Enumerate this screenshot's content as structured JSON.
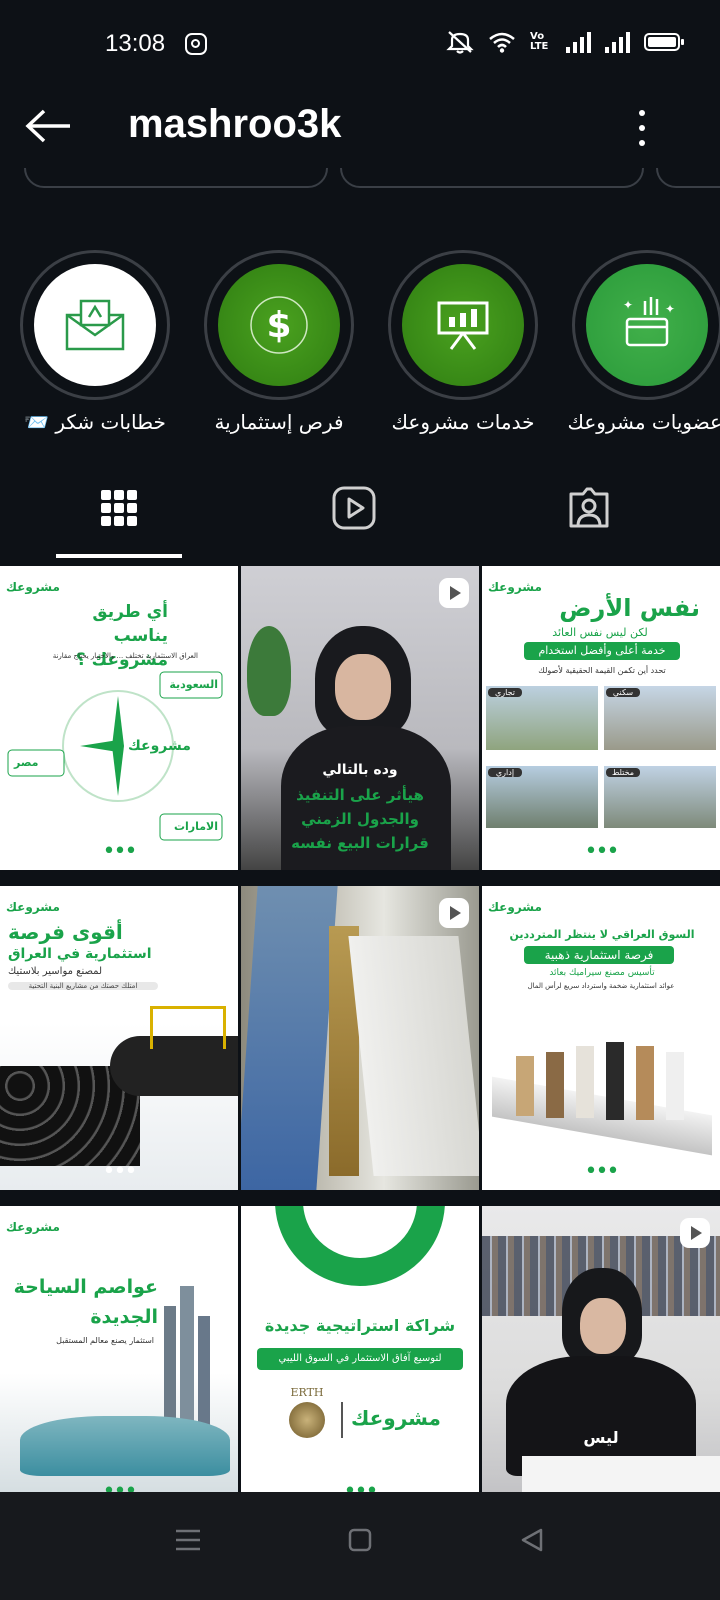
{
  "status_bar": {
    "time": "13:08",
    "network_label": "Vo LTE"
  },
  "header": {
    "username": "mashroo3k"
  },
  "highlights": [
    {
      "label": "خطابات شكر 📨",
      "icon": "envelope-icon",
      "style": "white"
    },
    {
      "label": "فرص إستثمارية",
      "icon": "dollar-icon",
      "style": "green"
    },
    {
      "label": "خدمات مشروعك",
      "icon": "presentation-chart-icon",
      "style": "green"
    },
    {
      "label": "عضويات مشروعك",
      "icon": "membership-card-icon",
      "style": "green"
    }
  ],
  "tabs": [
    {
      "name": "grid",
      "icon": "grid-icon",
      "active": true
    },
    {
      "name": "reels",
      "icon": "reels-icon",
      "active": false
    },
    {
      "name": "tagged",
      "icon": "tagged-person-icon",
      "active": false
    }
  ],
  "posts": [
    {
      "logo": "مشروعك",
      "title": "أي طريق يناسب مشروعك ؟",
      "subtitle": "العراق الاستثمارية تختلف ... والاختيار يحتاج مقارنة",
      "labels": [
        "السعودية",
        "مصر",
        "الامارات"
      ],
      "center": "مشروعك"
    },
    {
      "caption_lines": [
        "وده بالتالي",
        "هيأثر على التنفيذ",
        "والجدول الزمني",
        "قرارات البيع نفسه"
      ],
      "is_reel": true
    },
    {
      "logo": "مشروعك",
      "title": "نفس الأرض",
      "subtitle": "لكن ليس نفس العائد",
      "pill": "خدمة أعلى وأفضل استخدام",
      "note": "تحدد أين تكمن القيمة الحقيقية لأصولك",
      "tags": [
        "تجاري",
        "سكني",
        "إداري",
        "مختلط"
      ]
    },
    {
      "logo": "مشروعك",
      "title": "أقوى فرصة",
      "subtitle": "استثمارية في العراق",
      "note": "لمصنع مواسير بلاستيك",
      "pill": "امتلك حصتك من مشاريع البنية التحتية"
    },
    {
      "is_reel": true
    },
    {
      "logo": "مشروعك",
      "title": "السوق العراقي لا ينتظر المترددين",
      "pill": "فرصة استثمارية ذهبية",
      "subtitle": "تأسيس مصنع سيراميك بعائد",
      "note": "عوائد استثمارية ضخمة واسترداد سريع لرأس المال"
    },
    {
      "logo": "مشروعك",
      "title": "عواصم السياحة الجديدة",
      "note": "استثمار يصنع معالم المستقبل"
    },
    {
      "title": "شراكة استراتيجية جديدة",
      "pill": "لتوسيع آفاق الاستثمار في السوق الليبي",
      "partner": "ERTH",
      "logo": "مشروعك"
    },
    {
      "caption_lines": [
        "ليس"
      ],
      "is_reel": true
    }
  ],
  "colors": {
    "background": "#0d1116",
    "brand_green": "#1aa34a",
    "highlight_green": "#3f9a1e"
  }
}
